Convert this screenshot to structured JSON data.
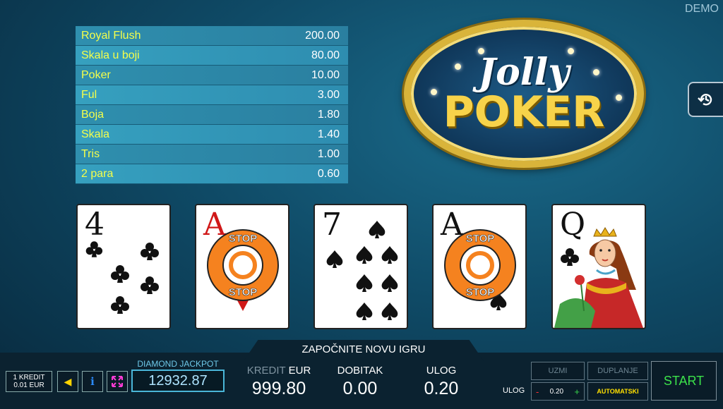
{
  "mode_badge": "DEMO",
  "paytable": [
    {
      "name": "Royal Flush",
      "value": "200.00"
    },
    {
      "name": "Skala u boji",
      "value": "80.00"
    },
    {
      "name": "Poker",
      "value": "10.00"
    },
    {
      "name": "Ful",
      "value": "3.00"
    },
    {
      "name": "Boja",
      "value": "1.80"
    },
    {
      "name": "Skala",
      "value": "1.40"
    },
    {
      "name": "Tris",
      "value": "1.00"
    },
    {
      "name": "2 para",
      "value": "0.60"
    }
  ],
  "logo": {
    "line1": "Jolly",
    "line2": "POKER"
  },
  "cards": [
    {
      "rank": "4",
      "suit": "clubs",
      "stop": false
    },
    {
      "rank": "A",
      "suit": "hearts",
      "stop": true,
      "stop_text": "STOP"
    },
    {
      "rank": "7",
      "suit": "spades",
      "stop": false
    },
    {
      "rank": "A",
      "suit": "spades",
      "stop": true,
      "stop_text": "STOP"
    },
    {
      "rank": "Q",
      "suit": "clubs",
      "stop": false,
      "face": "queen"
    }
  ],
  "message": "ZAPOČNITE NOVU IGRU",
  "kredit_unit": {
    "line1": "1 KREDIT",
    "line2": "0.01 EUR"
  },
  "jackpot": {
    "label": "DIAMOND JACKPOT",
    "value": "12932.87"
  },
  "stats": {
    "kredit_label": "KREDIT",
    "currency": "EUR",
    "kredit_value": "999.80",
    "dobitak_label": "DOBITAK",
    "dobitak_value": "0.00",
    "ulog_label": "ULOG",
    "ulog_value": "0.20"
  },
  "controls": {
    "uzmi": "UZMI",
    "duplanje": "DUPLANJE",
    "ulog_label": "ULOG",
    "ulog_minus": "-",
    "ulog_value": "0.20",
    "ulog_plus": "+",
    "automatski": "AUTOMATSKI",
    "start": "START"
  },
  "icons": {
    "history": "history-icon",
    "sound": "speaker-icon",
    "info": "info-icon",
    "fullscreen": "fullscreen-icon"
  }
}
